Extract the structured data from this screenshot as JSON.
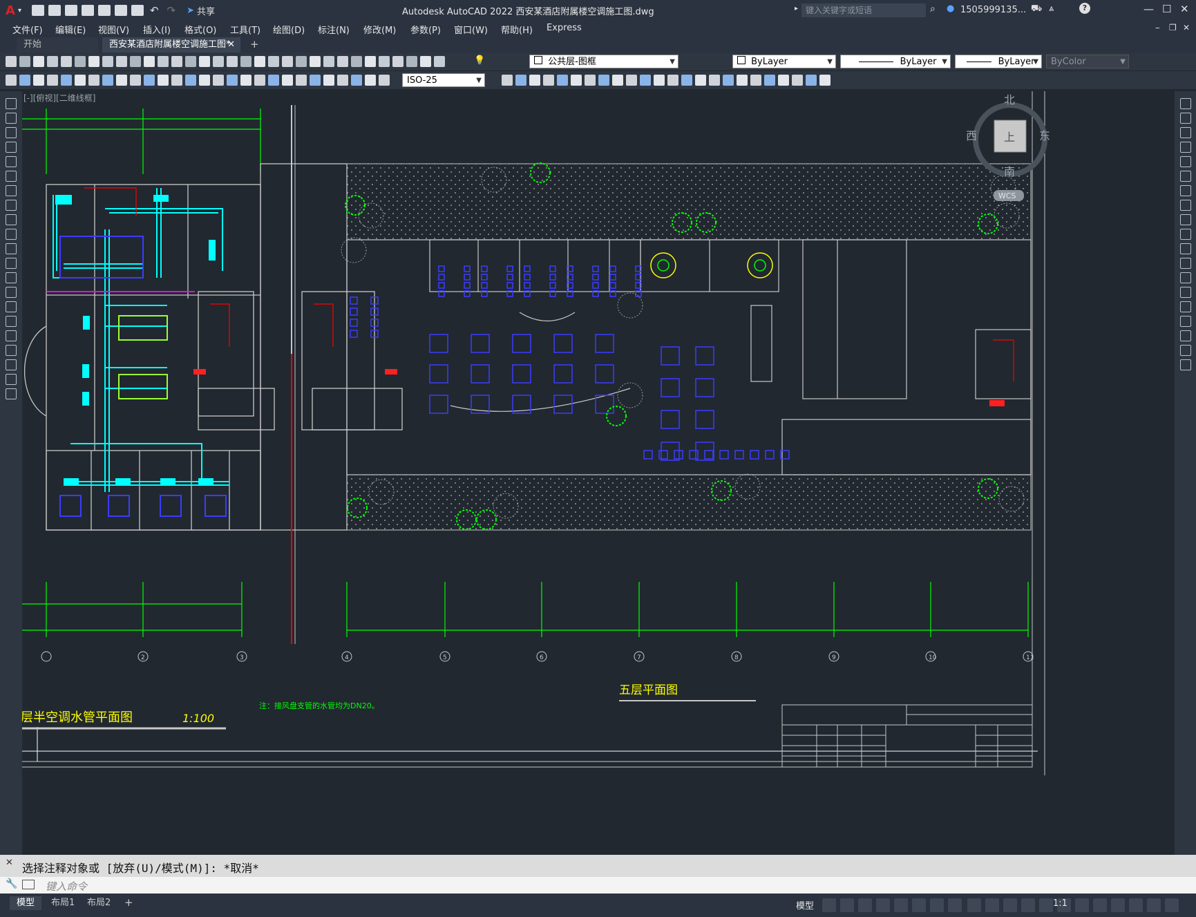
{
  "titlebar": {
    "app_title": "Autodesk AutoCAD 2022    西安某酒店附属楼空调施工图.dwg",
    "search_placeholder": "键入关键字或短语",
    "user": "1505999135...",
    "share_label": "共享"
  },
  "menu": [
    "文件(F)",
    "编辑(E)",
    "视图(V)",
    "插入(I)",
    "格式(O)",
    "工具(T)",
    "绘图(D)",
    "标注(N)",
    "修改(M)",
    "参数(P)",
    "窗口(W)",
    "帮助(H)",
    "Express"
  ],
  "tabs": [
    {
      "label": "开始",
      "active": false
    },
    {
      "label": "西安某酒店附属楼空调施工图*",
      "active": true
    }
  ],
  "toolbar": {
    "layer": "公共层-图框",
    "color": "ByLayer",
    "linetype": "ByLayer",
    "lineweight": "ByLayer",
    "plotstyle": "ByColor",
    "dimstyle": "ISO-25"
  },
  "viewport": {
    "label": "[-][俯视][二维线框]",
    "compass": {
      "north": "北",
      "south": "南",
      "east": "东",
      "west": "西",
      "top": "上"
    },
    "wcs": "WCS"
  },
  "drawing": {
    "title_left": "层半空调水管平面图",
    "scale": "1:100",
    "title_right": "五层平面图",
    "note": "注：接风盘支管的水管均为DN20。",
    "axis_labels": [
      "2",
      "3",
      "4",
      "5",
      "6",
      "7",
      "8",
      "9",
      "10",
      "11"
    ]
  },
  "command": {
    "history": "选择注释对象或 [放弃(U)/模式(M)]: *取消*",
    "placeholder": "键入命令"
  },
  "layouts": [
    {
      "label": "模型",
      "active": true
    },
    {
      "label": "布局1",
      "active": false
    },
    {
      "label": "布局2",
      "active": false
    }
  ],
  "status": {
    "model_label": "模型",
    "scale": "1:1"
  },
  "colors": {
    "background": "#212830",
    "green": "#00ff00",
    "cyan": "#00ffff",
    "red": "#ff0000",
    "blue": "#3c3cff",
    "yellow": "#ffff00",
    "magenta": "#ff00ff"
  }
}
